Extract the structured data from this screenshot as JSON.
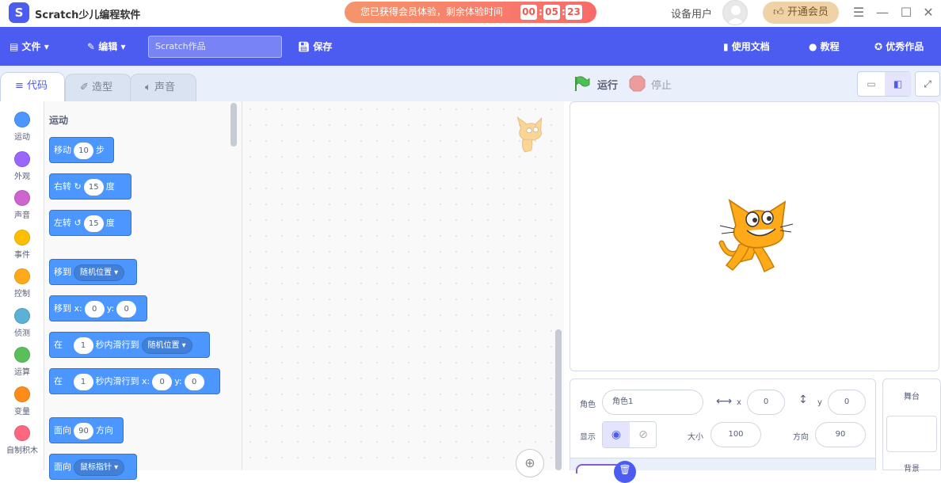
{
  "app": {
    "logo_glyph": "S",
    "title": "Scratch少儿编程软件"
  },
  "trial": {
    "text": "您已获得会员体验，剩余体验时间",
    "hours": "00",
    "minutes": "05",
    "seconds": "23"
  },
  "user": {
    "name": "设备用户",
    "vip_button": "开通会员"
  },
  "menu": {
    "file": "文件",
    "edit": "编辑",
    "project_placeholder": "Scratch作品",
    "save": "保存",
    "docs": "使用文档",
    "tutorial": "教程",
    "showcase": "优秀作品"
  },
  "tabs": {
    "code": "代码",
    "costumes": "造型",
    "sounds": "声音"
  },
  "controls": {
    "run": "运行",
    "stop": "停止"
  },
  "categories": [
    {
      "label": "运动",
      "color": "#4c97ff"
    },
    {
      "label": "外观",
      "color": "#9966ff"
    },
    {
      "label": "声音",
      "color": "#cf63cf"
    },
    {
      "label": "事件",
      "color": "#ffbf00"
    },
    {
      "label": "控制",
      "color": "#ffab19"
    },
    {
      "label": "侦测",
      "color": "#5cb1d6"
    },
    {
      "label": "运算",
      "color": "#59c059"
    },
    {
      "label": "变量",
      "color": "#ff8c1a"
    },
    {
      "label": "自制积木",
      "color": "#ff6680"
    }
  ],
  "palette": {
    "heading": "运动",
    "move": {
      "a": "移动",
      "v": "10",
      "b": "步"
    },
    "turn_right": {
      "a": "右转",
      "icon": "↻",
      "v": "15",
      "b": "度"
    },
    "turn_left": {
      "a": "左转",
      "icon": "↺",
      "v": "15",
      "b": "度"
    },
    "goto": {
      "a": "移到",
      "dd": "随机位置"
    },
    "goto_xy": {
      "a": "移到 x:",
      "x": "0",
      "b": "y:",
      "y": "0"
    },
    "glide": {
      "a": "在",
      "v": "1",
      "b": "秒内滑行到",
      "dd": "随机位置"
    },
    "glide_xy": {
      "a": "在",
      "v": "1",
      "b": "秒内滑行到 x:",
      "x": "0",
      "c": "y:",
      "y": "0"
    },
    "point": {
      "a": "面向",
      "v": "90",
      "b": "方向"
    },
    "point_towards": {
      "a": "面向",
      "dd": "鼠标指针"
    }
  },
  "sprite": {
    "name_label": "角色",
    "name": "角色1",
    "x_label": "x",
    "x": "0",
    "y_label": "y",
    "y": "0",
    "show_label": "显示",
    "size_label": "大小",
    "size": "100",
    "dir_label": "方向",
    "direction": "90"
  },
  "stage_panel": {
    "title": "舞台",
    "backdrop_label": "背景"
  }
}
